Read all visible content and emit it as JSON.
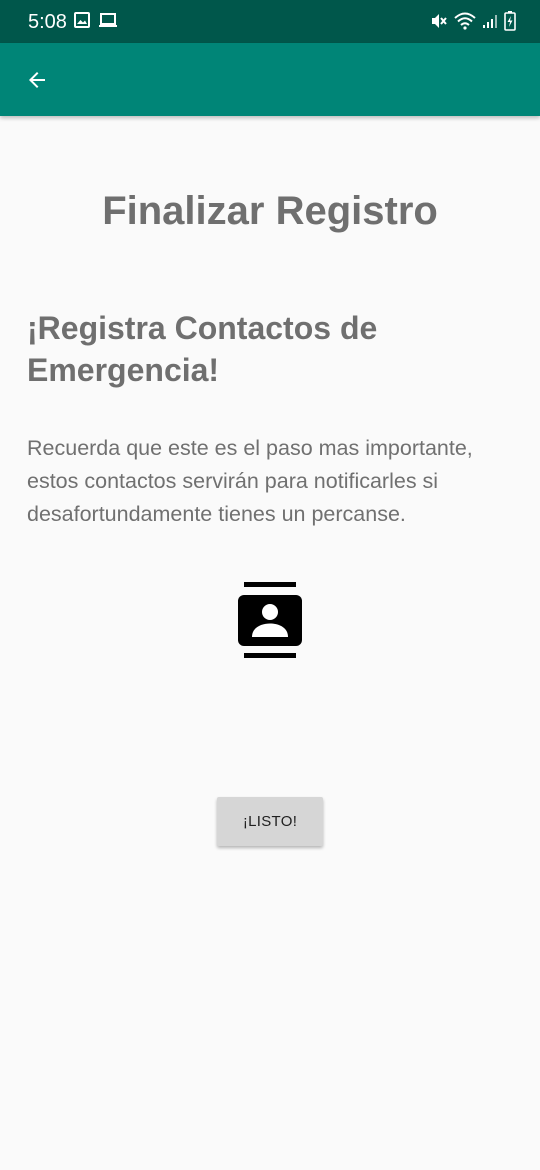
{
  "status_bar": {
    "time": "5:08",
    "left_icons": [
      "image-icon",
      "laptop-icon"
    ],
    "right_icons": [
      "mute-vibrate-icon",
      "wifi-icon",
      "signal-icon",
      "battery-charging-icon"
    ],
    "background": "#00574b"
  },
  "app_bar": {
    "background": "#008577",
    "back_icon": "arrow-back-icon"
  },
  "main": {
    "title": "Finalizar Registro",
    "heading": "¡Registra Contactos de Emergencia!",
    "description": "Recuerda que este es el paso mas importante, estos contactos servirán para notificarles si desafortundamente tienes un percanse.",
    "illustration_icon": "contacts-icon",
    "button_label": "¡LISTO!"
  }
}
